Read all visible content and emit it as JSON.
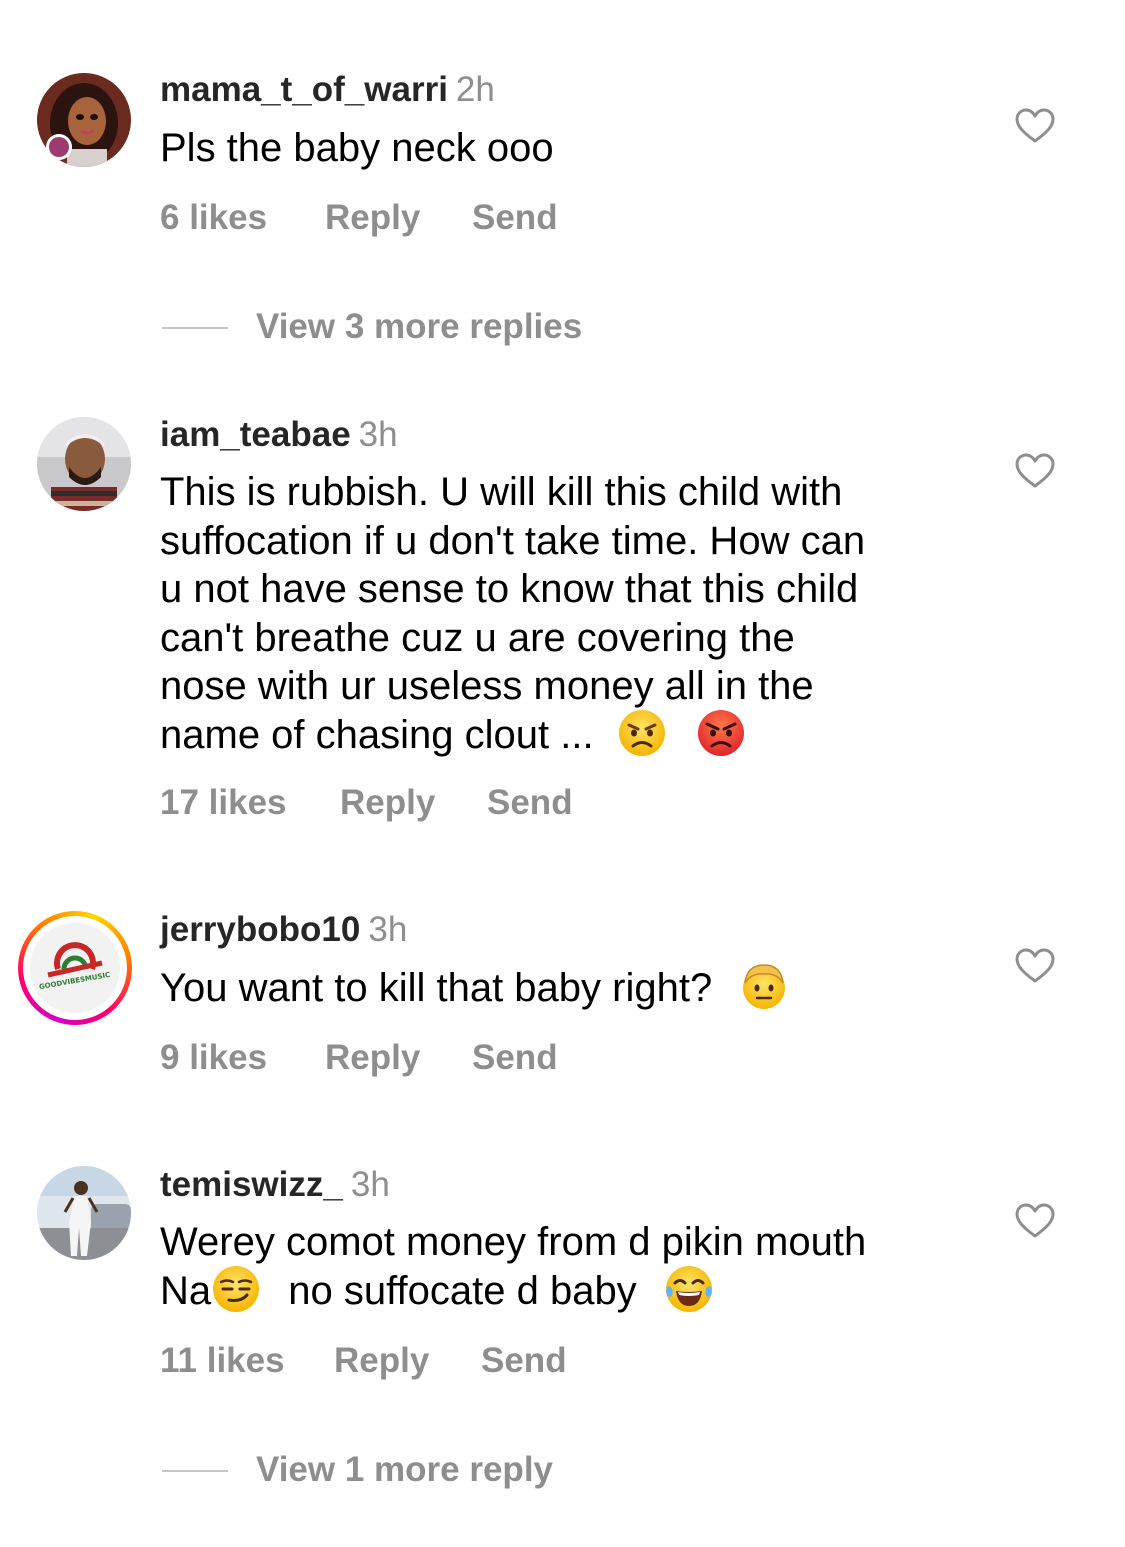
{
  "comments": [
    {
      "username": "mama_t_of_warri",
      "time": "2h",
      "lines": [
        "Pls the baby neck ooo"
      ],
      "likes": "6 likes",
      "reply": "Reply",
      "send": "Send",
      "more_replies": "View 3 more replies"
    },
    {
      "username": "iam_teabae",
      "time": "3h",
      "lines": [
        "This is rubbish.  U will kill this child with",
        "suffocation if u don't take time. How can",
        "u not have sense to know that this child",
        "can't breathe cuz u are covering the",
        "nose with ur useless money all in the",
        "name of chasing clout ..."
      ],
      "emojis": [
        "unamused-angry-face-emoji",
        "red-angry-face-emoji"
      ],
      "likes": "17 likes",
      "reply": "Reply",
      "send": "Send"
    },
    {
      "username": "jerrybobo10",
      "time": "3h",
      "lines": [
        "You want to kill that baby right?"
      ],
      "emojis": [
        "blond-man-emoji"
      ],
      "avatar_logo_text": "GOODVIBESMUSIC",
      "likes": "9 likes",
      "reply": "Reply",
      "send": "Send"
    },
    {
      "username": "temiswizz_",
      "time": "3h",
      "lines": [
        "Werey comot money from d pikin mouth",
        "Na",
        "no suffocate d baby"
      ],
      "emojis": [
        "smirking-face-emoji",
        "tears-of-joy-emoji"
      ],
      "likes": "11 likes",
      "reply": "Reply",
      "send": "Send",
      "more_replies": "View 1 more reply"
    }
  ],
  "colors": {
    "username": "#262626",
    "secondary_text": "#8e8e8e",
    "divider": "#c7c7c7",
    "story_ring": [
      "#d300c5",
      "#ff0069",
      "#ff7a00",
      "#ffd600"
    ]
  }
}
